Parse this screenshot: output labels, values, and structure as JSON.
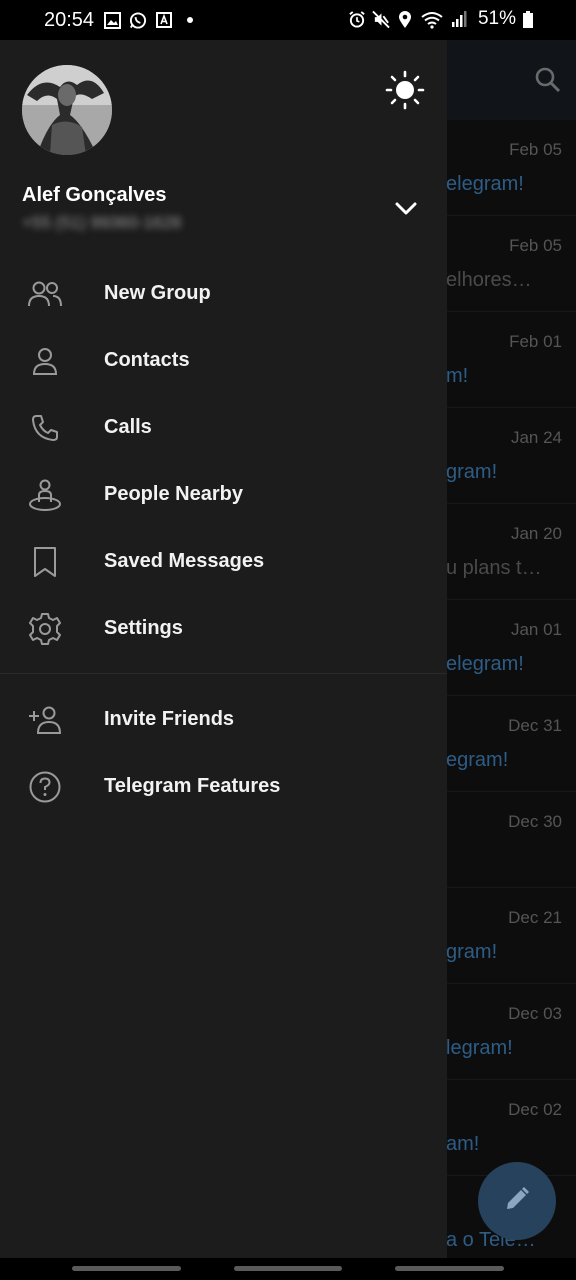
{
  "status_bar": {
    "time": "20:54",
    "battery_percent": "51%",
    "left_icons": [
      "gallery-icon",
      "whatsapp-icon",
      "font-app-icon",
      "dot-icon"
    ],
    "right_icons": [
      "alarm-icon",
      "mute-icon",
      "location-icon",
      "wifi-icon",
      "signal-icon",
      "battery-icon"
    ]
  },
  "drawer": {
    "user": {
      "name": "Alef Gonçalves",
      "phone": "+55 (51) 99360-1628"
    },
    "menu_items": [
      {
        "label": "New Group",
        "icon": "group-icon"
      },
      {
        "label": "Contacts",
        "icon": "person-icon"
      },
      {
        "label": "Calls",
        "icon": "phone-icon"
      },
      {
        "label": "People Nearby",
        "icon": "nearby-icon"
      },
      {
        "label": "Saved Messages",
        "icon": "bookmark-icon"
      },
      {
        "label": "Settings",
        "icon": "gear-icon"
      }
    ],
    "secondary_items": [
      {
        "label": "Invite Friends",
        "icon": "add-person-icon"
      },
      {
        "label": "Telegram Features",
        "icon": "question-icon"
      }
    ]
  },
  "chat_list": {
    "rows": [
      {
        "date": "Feb 05",
        "preview": "elegram!"
      },
      {
        "date": "Feb 05",
        "preview": "elhores…"
      },
      {
        "date": "Feb 01",
        "preview": "m!"
      },
      {
        "date": "Jan 24",
        "preview": "gram!"
      },
      {
        "date": "Jan 20",
        "preview": "u plans t…"
      },
      {
        "date": "Jan 01",
        "preview": "elegram!"
      },
      {
        "date": "Dec 31",
        "preview": "egram!"
      },
      {
        "date": "Dec 30",
        "preview": ""
      },
      {
        "date": "Dec 21",
        "preview": "gram!"
      },
      {
        "date": "Dec 03",
        "preview": "legram!"
      },
      {
        "date": "Dec 02",
        "preview": "am!"
      },
      {
        "date": "",
        "preview": "a o Tele…"
      }
    ]
  },
  "colors": {
    "drawer_bg": "#1c1c1c",
    "link_blue": "#2d5d86",
    "fab_bg": "#27425c"
  }
}
